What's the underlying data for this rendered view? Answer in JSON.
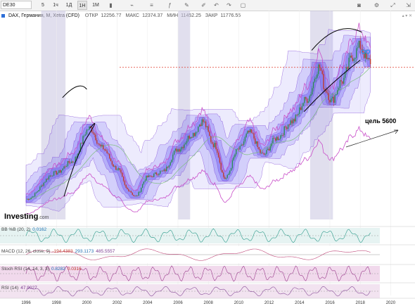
{
  "toolbar": {
    "symbol": "DE30",
    "timeframes": [
      "5",
      "1ч",
      "1Д",
      "1Н",
      "1М"
    ],
    "active_timeframe": "1Н"
  },
  "header": {
    "instrument": "DAX, Германия, M, Xetra (CFD)",
    "open_label": "ОТКР",
    "open": "12256.77",
    "high_label": "МАКС",
    "high": "12374.37",
    "low_label": "МИН",
    "low": "11452.25",
    "close_label": "ЗАКР",
    "close": "11776.55"
  },
  "annotation": "цель 5600",
  "watermark": {
    "brand": "Investing",
    "domain": ".com"
  },
  "indicators": {
    "bb": {
      "label": "BB %B (20, 2)",
      "value": "0.0162"
    },
    "macd": {
      "label": "MACD (12, 26, close, 9)",
      "v1": "-194.4383",
      "v2": "293.1173",
      "v3": "485.5557"
    },
    "stoch": {
      "label": "Stoch RSI (14, 14, 3, 3)",
      "v1": "0.8282",
      "v2": "0.0316"
    },
    "rsi": {
      "label": "RSI (14)",
      "value": "47.9027"
    }
  },
  "colors": {
    "up": "#2e8b57",
    "down": "#c0392b",
    "band_fill": "#4b3df0",
    "band_line": "#7b3fd4",
    "resistance": "#e0392b"
  },
  "chart_data": {
    "type": "candlestick",
    "title": "DAX, Германия, M, Xetra (CFD)",
    "x_ticks": [
      "1996",
      "1998",
      "2000",
      "2002",
      "2004",
      "2006",
      "2008",
      "2010",
      "2012",
      "2014",
      "2016",
      "2018",
      "2020"
    ],
    "path_years": [
      1996.0,
      1998.0,
      1999.0,
      2000.2,
      2001.0,
      2002.0,
      2002.7,
      2003.2,
      2004.0,
      2005.0,
      2006.0,
      2007.0,
      2007.6,
      2008.4,
      2009.1,
      2010.0,
      2010.7,
      2011.6,
      2012.5,
      2013.5,
      2014.5,
      2015.3,
      2015.7,
      2016.1,
      2016.8,
      2017.5,
      2018.0,
      2018.5
    ],
    "path_values": [
      2300,
      4200,
      5000,
      7400,
      6000,
      4500,
      3000,
      2500,
      3900,
      4300,
      5900,
      7000,
      7900,
      6200,
      3800,
      5900,
      7100,
      5500,
      6700,
      7900,
      9500,
      11800,
      10200,
      9400,
      10800,
      12600,
      13300,
      12200
    ],
    "last_close": 11776.55,
    "target_value": 5600,
    "target_label": "цель 5600"
  }
}
